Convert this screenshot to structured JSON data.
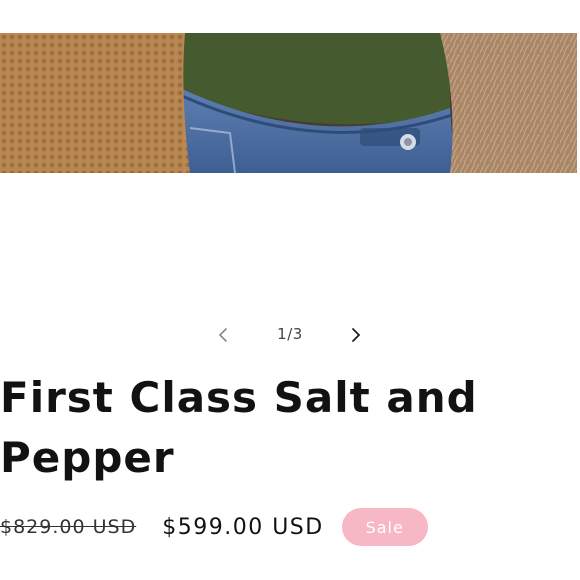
{
  "gallery": {
    "counter": "1/3",
    "prev_icon": "chevron-left-icon",
    "next_icon": "chevron-right-icon"
  },
  "product": {
    "title": "First Class Salt and Pepper",
    "price_regular": "$829.00 USD",
    "price_sale": "$599.00 USD",
    "badge": "Sale"
  },
  "colors": {
    "badge_bg": "#f7b7c4",
    "text": "#121212"
  }
}
